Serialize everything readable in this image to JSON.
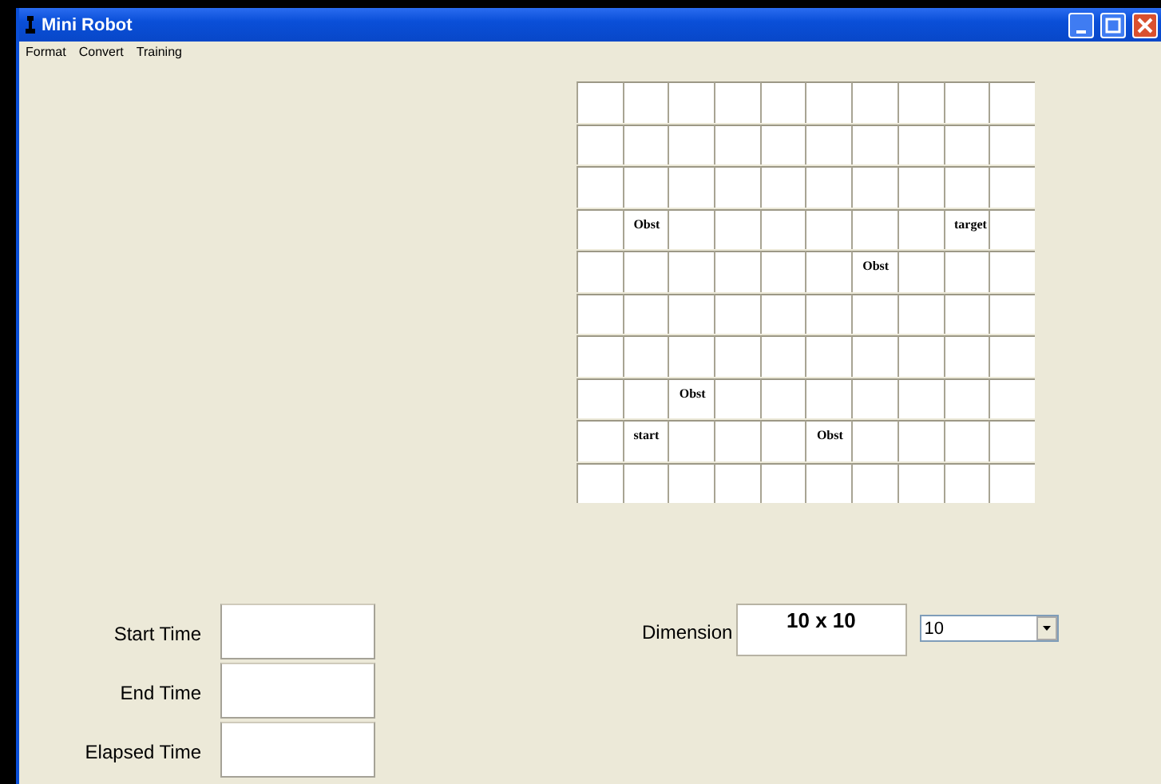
{
  "window": {
    "title": "Mini Robot"
  },
  "menu": [
    "Format",
    "Convert",
    "Training"
  ],
  "grid": {
    "rows": [
      {
        "cells": [
          {},
          {},
          {},
          {},
          {},
          {},
          {},
          {},
          {},
          {}
        ]
      },
      {
        "cells": [
          {},
          {},
          {},
          {},
          {},
          {},
          {},
          {},
          {},
          {}
        ]
      },
      {
        "cells": [
          {},
          {},
          {},
          {},
          {},
          {},
          {},
          {},
          {},
          {}
        ]
      },
      {
        "cells": [
          {},
          {
            "label": "Obst"
          },
          {},
          {},
          {},
          {},
          {},
          {},
          {
            "label": "target"
          },
          {}
        ]
      },
      {
        "cells": [
          {},
          {},
          {},
          {},
          {},
          {},
          {
            "label": "Obst"
          },
          {},
          {},
          {}
        ]
      },
      {
        "cells": [
          {},
          {},
          {},
          {},
          {},
          {},
          {},
          {},
          {},
          {}
        ]
      },
      {
        "cells": [
          {},
          {},
          {},
          {},
          {},
          {},
          {},
          {},
          {},
          {}
        ]
      },
      {
        "cells": [
          {},
          {},
          {
            "label": "Obst"
          },
          {},
          {},
          {},
          {},
          {},
          {},
          {}
        ]
      },
      {
        "cells": [
          {},
          {
            "label": "start"
          },
          {},
          {},
          {},
          {
            "label": "Obst"
          },
          {},
          {},
          {},
          {}
        ]
      },
      {
        "cells": [
          {},
          {},
          {},
          {},
          {},
          {},
          {},
          {},
          {},
          {}
        ]
      }
    ]
  },
  "times": [
    {
      "label": "Start Time"
    },
    {
      "label": "End Time"
    },
    {
      "label": "Elapsed Time"
    }
  ],
  "dimension": {
    "label": "Dimension",
    "display": "10 x 10",
    "select": "10"
  }
}
